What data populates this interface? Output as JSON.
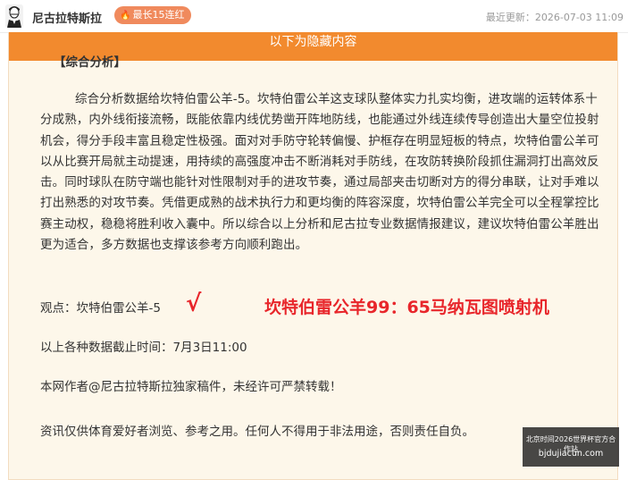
{
  "header": {
    "author": "尼古拉特斯拉",
    "badge": "最长15连红",
    "last_update": "最近更新：2026-07-03 11:09"
  },
  "hidden": {
    "banner": "以下为隐藏内容"
  },
  "article": {
    "section_title": "【综合分析】",
    "analysis": "综合分析数据给坎特伯雷公羊-5。坎特伯雷公羊这支球队整体实力扎实均衡，进攻端的运转体系十分成熟，内外线衔接流畅，既能依靠内线优势凿开阵地防线，也能通过外线连续传导创造出大量空位投射机会，得分手段丰富且稳定性极强。面对对手防守轮转偏慢、护框存在明显短板的特点，坎特伯雷公羊可以从比赛开局就主动提速，用持续的高强度冲击不断消耗对手防线，在攻防转换阶段抓住漏洞打出高效反击。同时球队在防守端也能针对性限制对手的进攻节奏，通过局部夹击切断对方的得分串联，让对手难以打出熟悉的对攻节奏。凭借更成熟的战术执行力和更均衡的阵容深度，坎特伯雷公羊完全可以全程掌控比赛主动权，稳稳将胜利收入囊中。所以综合以上分析和尼古拉专业数据情报建议，建议坎特伯雷公羊胜出更为适合，多方数据也支撑该参考方向顺利跑出。",
    "viewpoint": "观点：坎特伯雷公羊-5",
    "check": "√",
    "score": "坎特伯雷公羊99：65马纳瓦图喷射机",
    "deadline": "以上各种数据截止时间：7月3日11:00",
    "copyright": "本网作者@尼古拉特斯拉独家稿件，未经许可严禁转载！",
    "disclaimer": "资讯仅供体育爱好者浏览、参考之用。任何人不得用于非法用途，否则责任自负。"
  },
  "watermark": {
    "line1": "北京时间2026世界杯官方合作站",
    "line2": "bjdujiacun.com"
  },
  "colors": {
    "banner": "#f28a2e",
    "badge": "#f08a5d",
    "highlight": "#e8262b",
    "content_bg": "#fdf7ea"
  },
  "icons": {
    "avatar": "tesla-portrait-avatar",
    "badge_icon": "flame-icon"
  }
}
